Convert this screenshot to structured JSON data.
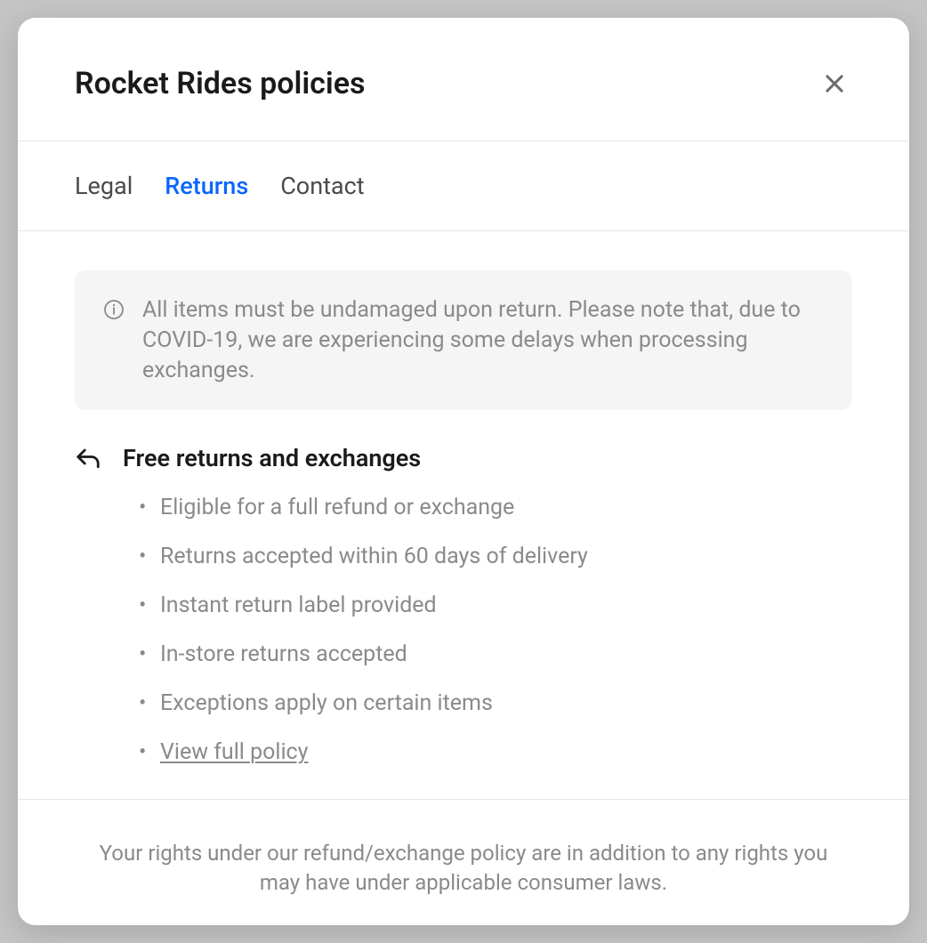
{
  "modal": {
    "title": "Rocket Rides policies"
  },
  "tabs": {
    "items": [
      {
        "label": "Legal",
        "active": false
      },
      {
        "label": "Returns",
        "active": true
      },
      {
        "label": "Contact",
        "active": false
      }
    ]
  },
  "notice": {
    "text": "All items must be undamaged upon return. Please note that, due to COVID-19, we are experiencing some delays when processing exchanges."
  },
  "returns": {
    "heading": "Free returns and exchanges",
    "items": [
      "Eligible for a full refund or exchange",
      "Returns accepted within 60 days of delivery",
      "Instant return label provided",
      "In-store returns accepted",
      "Exceptions apply on certain items"
    ],
    "link_label": "View full policy"
  },
  "footer": {
    "text": "Your rights under our refund/exchange policy are in addition to any rights you may have under applicable consumer laws."
  }
}
